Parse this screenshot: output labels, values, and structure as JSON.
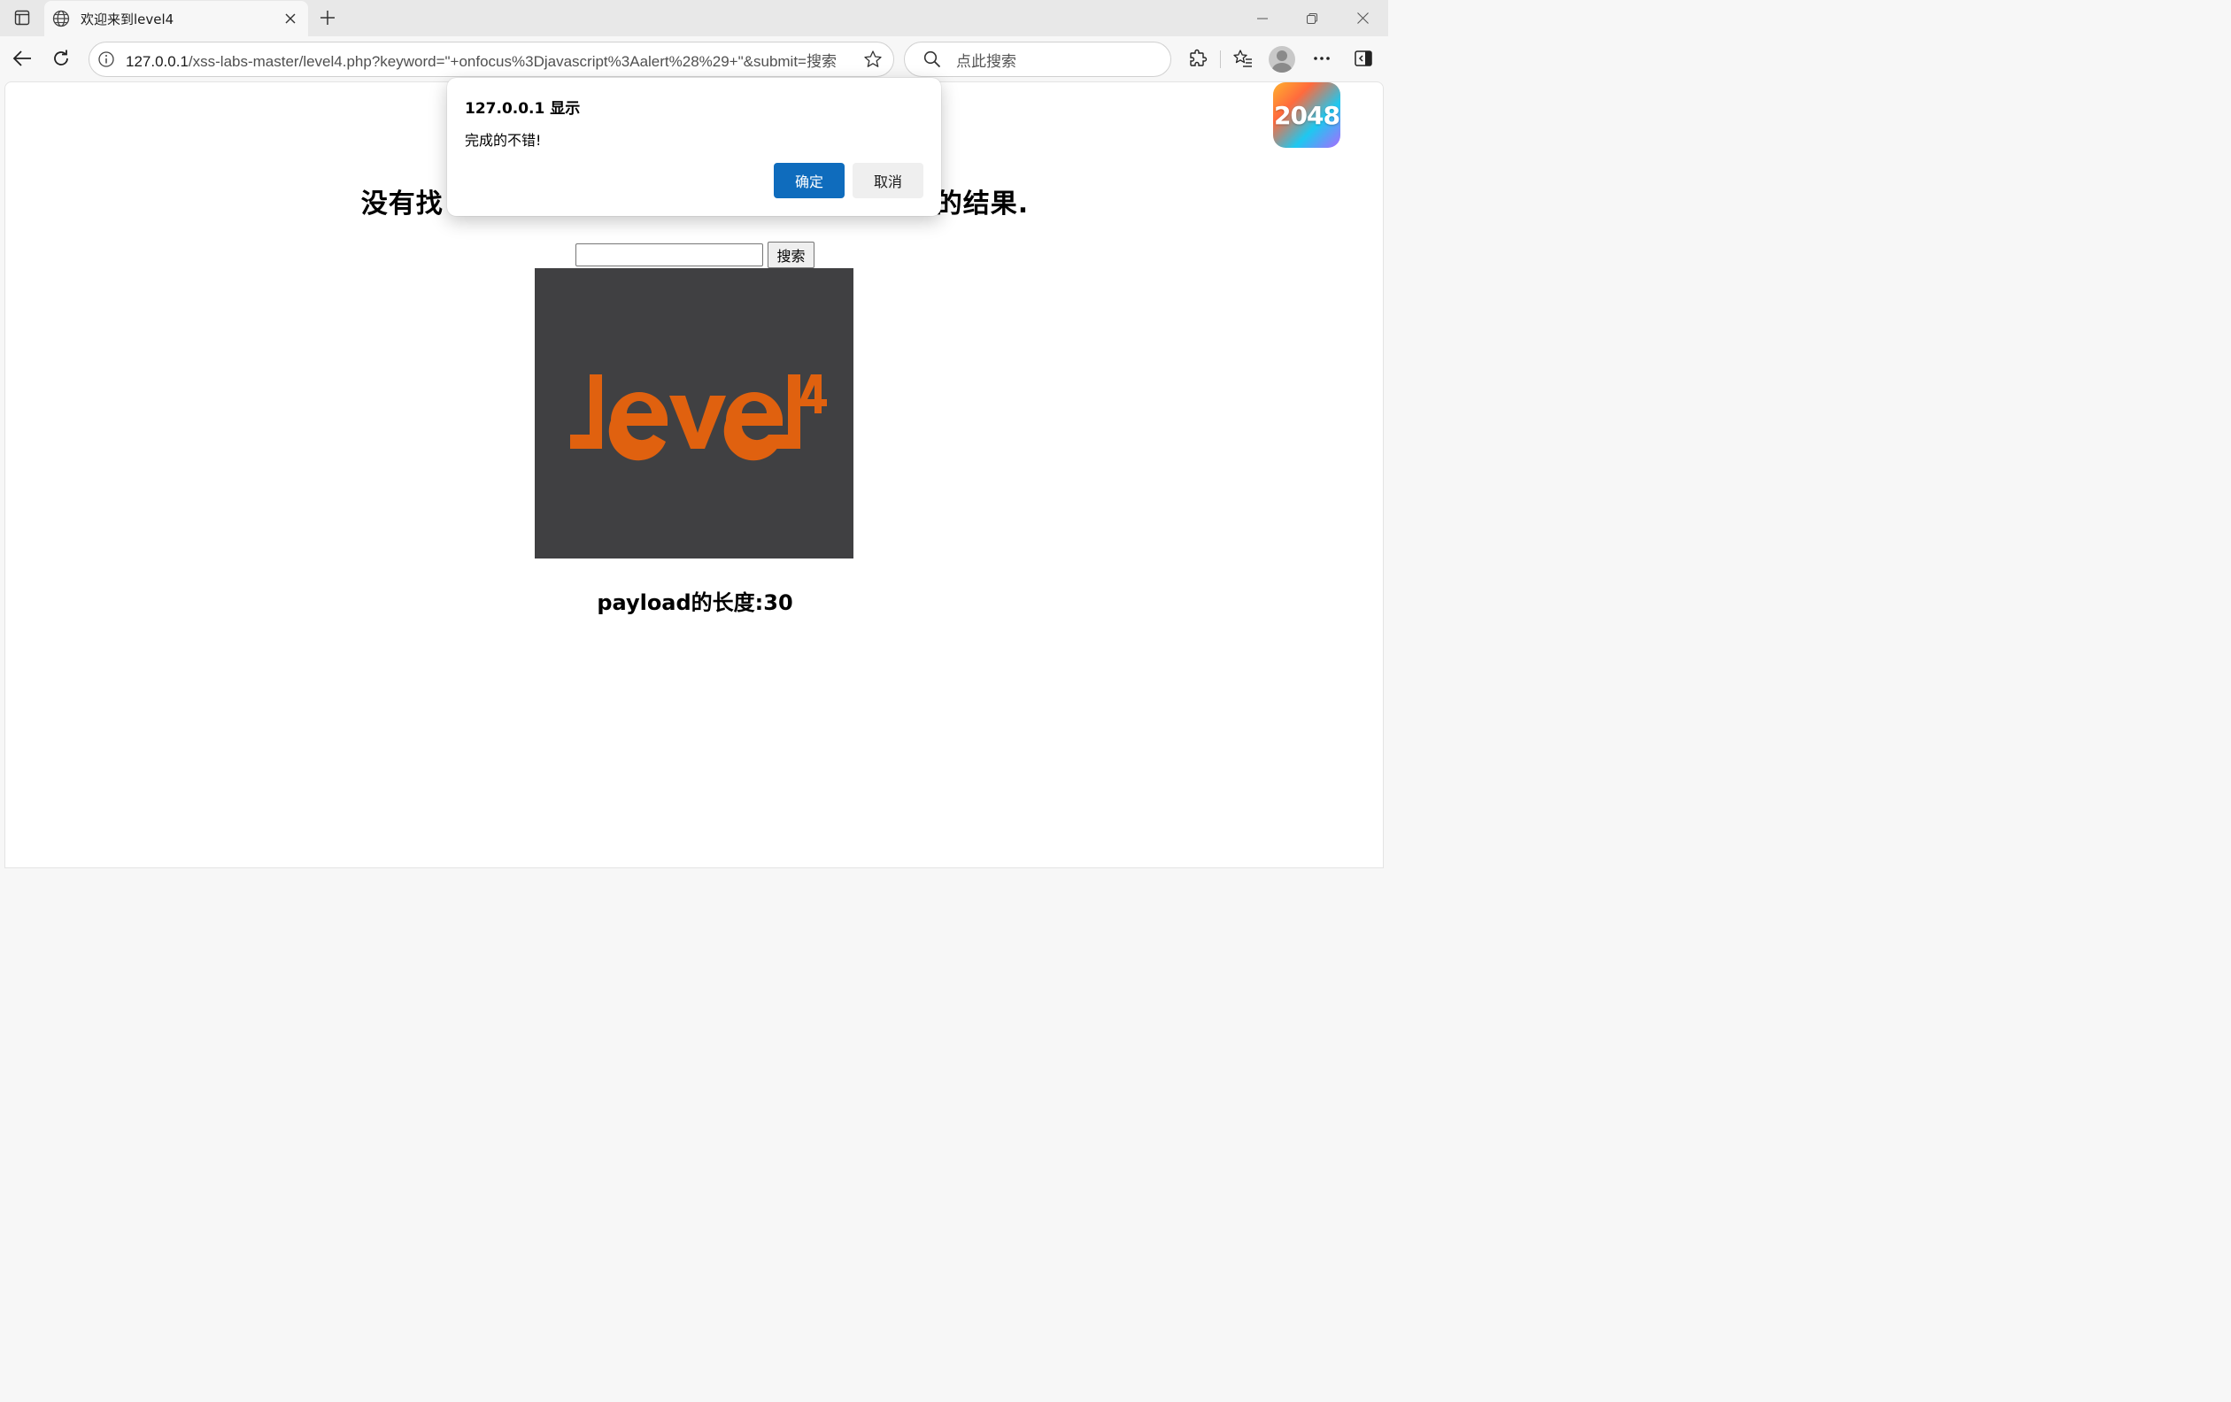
{
  "browser": {
    "tab": {
      "title": "欢迎来到level4",
      "favicon": "globe-icon"
    },
    "address": {
      "host": "127.0.0.1",
      "path": "/xss-labs-master/level4.php?keyword=\"+onfocus%3Djavascript%3Aalert%28%29+\"&submit=搜索"
    },
    "search_placeholder": "点此搜索",
    "accent_color": "#0f6cbd"
  },
  "page": {
    "heading_left": "没有找",
    "heading_right": "的结果.",
    "search_button": "搜索",
    "search_value": "",
    "image_label_main": "level",
    "image_label_sup": "4",
    "payload_text": "payload的长度:30",
    "extension_badge": "2048"
  },
  "dialog": {
    "title": "127.0.0.1 显示",
    "message": "完成的不错!",
    "ok_label": "确定",
    "cancel_label": "取消"
  }
}
